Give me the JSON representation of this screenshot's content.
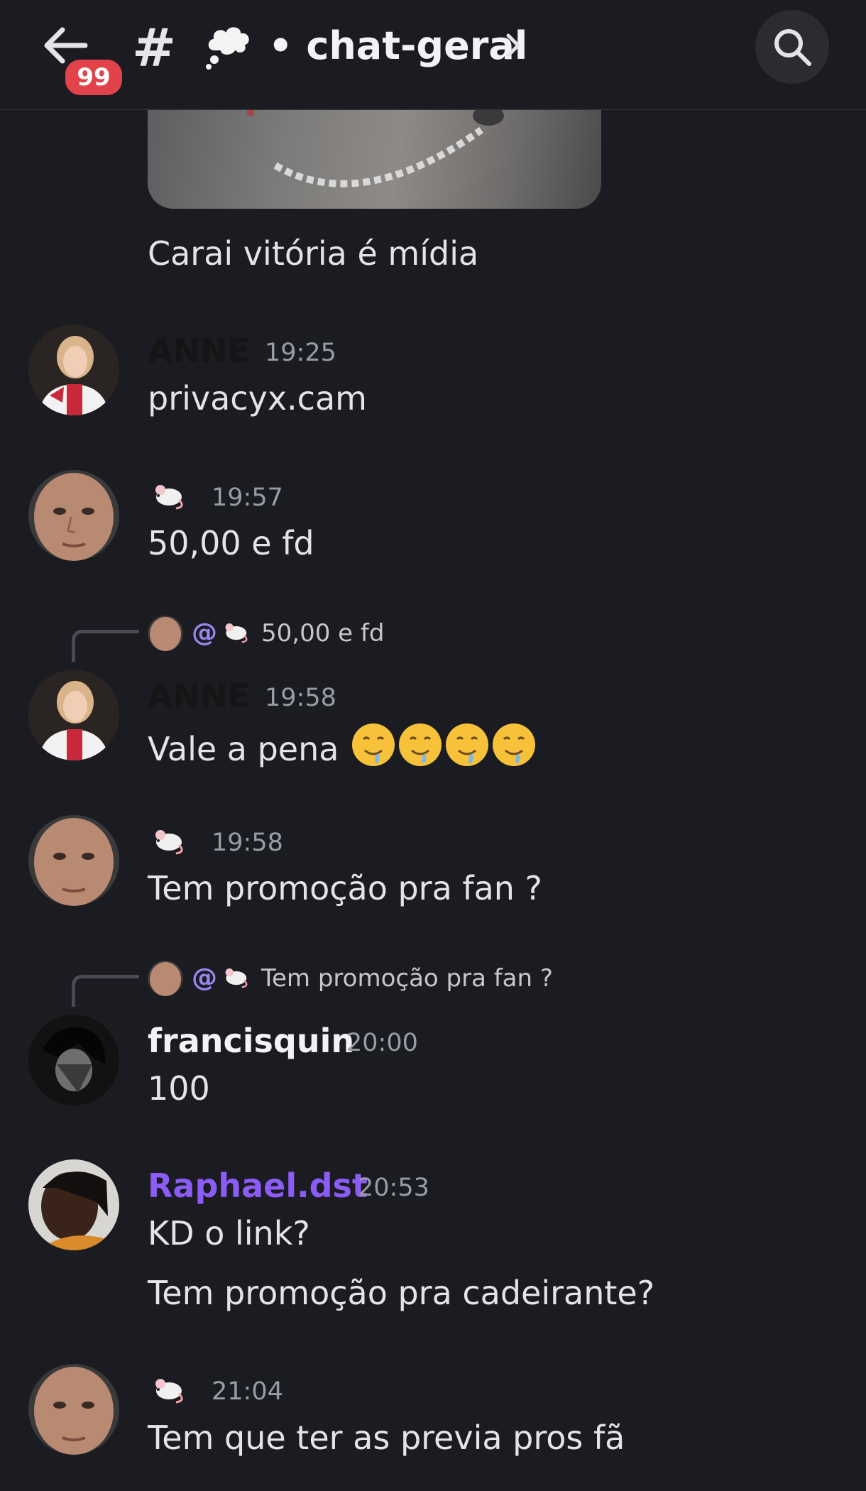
{
  "header": {
    "notification_count": "99",
    "channel_name": "• chat-geral",
    "channel_emoji": "thought-balloon"
  },
  "attachment_caption": "Carai vitória é mídia",
  "messages": [
    {
      "author": "ANNE",
      "time": "19:25",
      "lines": [
        "privacyx.cam"
      ]
    },
    {
      "author": "🐁",
      "time": "19:57",
      "lines": [
        "50,00 e fd"
      ]
    },
    {
      "reply_to": "50,00 e fd",
      "author": "ANNE",
      "time": "19:58",
      "lines": [
        "Vale a pena"
      ],
      "emoji": "drooling-face ×4"
    },
    {
      "author": "🐁",
      "time": "19:58",
      "lines": [
        "Tem promoção pra fan ?"
      ]
    },
    {
      "reply_to": "Tem promoção pra fan ?",
      "author": "francisquin",
      "time": "20:00",
      "lines": [
        "100"
      ]
    },
    {
      "author": "Raphael.dst",
      "time": "20:53",
      "lines": [
        "KD o link?",
        "Tem promoção pra cadeirante?"
      ]
    },
    {
      "author": "🐁",
      "time": "21:04",
      "lines": [
        "Tem que ter as previa pros fã"
      ]
    }
  ],
  "mention_prefix": "@",
  "colors": {
    "background": "#1b1c21",
    "anne_name": "#151515",
    "raphael_name": "#8b5cf6",
    "francisquin_name": "#f2f3f5",
    "badge": "#e2434a",
    "mention": "#9c84ef"
  }
}
